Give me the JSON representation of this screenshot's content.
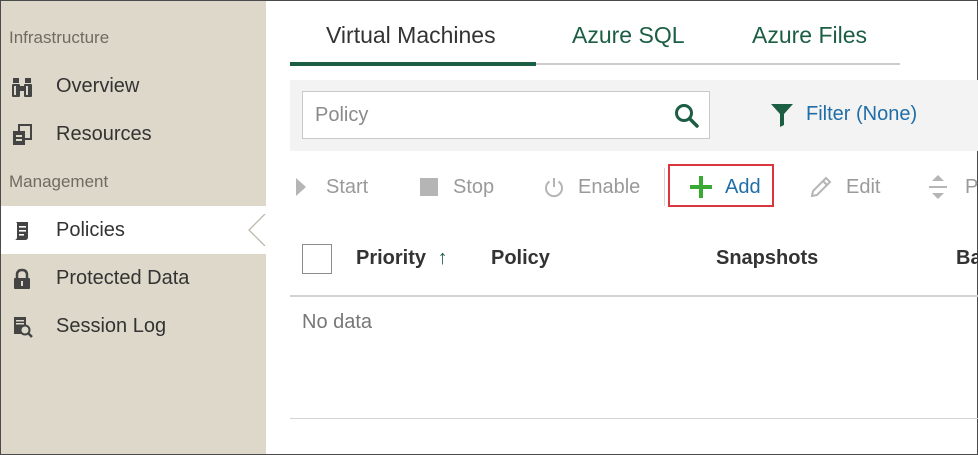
{
  "sidebar": {
    "sections": [
      {
        "title": "Infrastructure"
      },
      {
        "title": "Management"
      }
    ],
    "items": [
      {
        "label": "Overview",
        "icon": "binoculars-icon"
      },
      {
        "label": "Resources",
        "icon": "resources-icon"
      },
      {
        "label": "Policies",
        "icon": "policy-document-icon",
        "active": true
      },
      {
        "label": "Protected Data",
        "icon": "lock-icon"
      },
      {
        "label": "Session Log",
        "icon": "session-log-icon"
      }
    ]
  },
  "tabs": [
    {
      "label": "Virtual Machines",
      "active": true
    },
    {
      "label": "Azure SQL"
    },
    {
      "label": "Azure Files"
    }
  ],
  "search": {
    "placeholder": "Policy",
    "value": ""
  },
  "filter": {
    "label": "Filter (None)"
  },
  "toolbar": {
    "start": "Start",
    "stop": "Stop",
    "enable": "Enable",
    "add": "Add",
    "edit": "Edit",
    "priority_partial": "P"
  },
  "table": {
    "columns": [
      "Priority",
      "Policy",
      "Snapshots",
      "Ba"
    ],
    "sort_indicator": "↑",
    "empty_text": "No data"
  },
  "colors": {
    "sidebar_bg": "#ddd8ca",
    "accent_green": "#1b5e43",
    "add_green": "#3aaa35",
    "link_blue": "#1f6ea8",
    "highlight_red": "#d9363e"
  }
}
